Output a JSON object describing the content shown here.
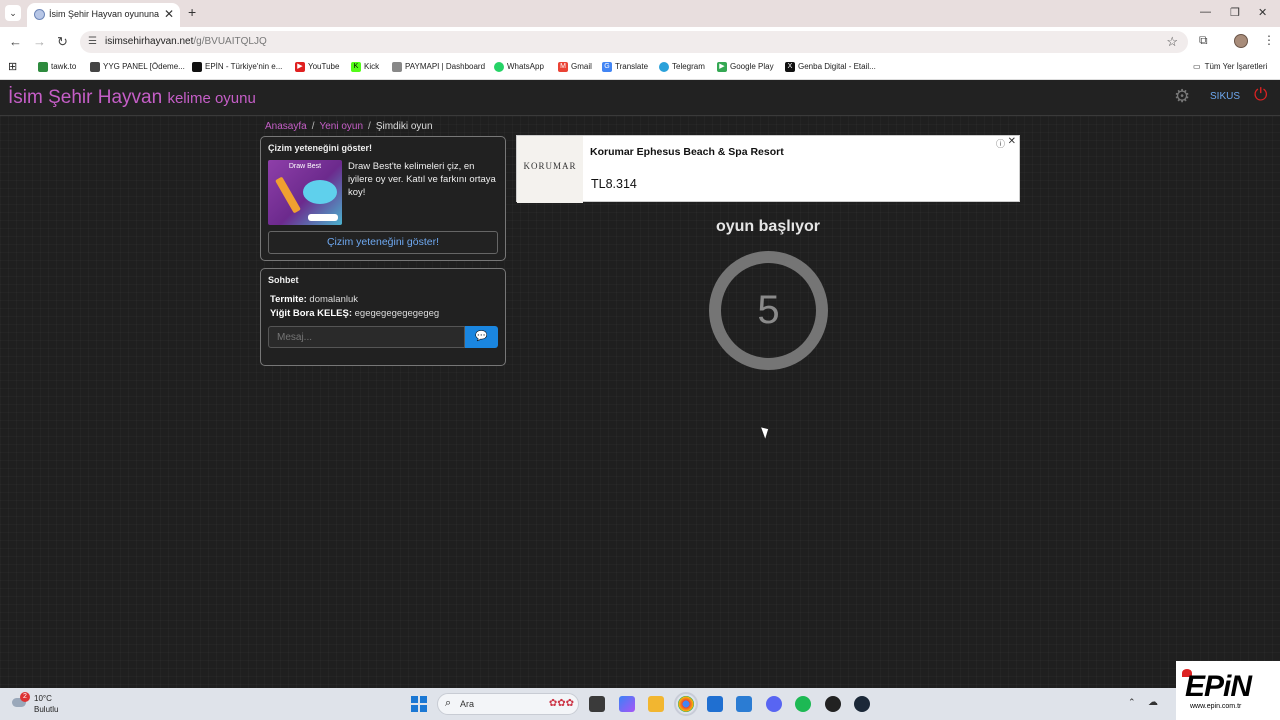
{
  "browser": {
    "tab_title": "İsim Şehir Hayvan oyununa katıl",
    "url_domain": "isimsehirhayvan.net",
    "url_path": "/g/BVUAITQLJQ",
    "bookmarks": [
      {
        "label": "tawk.to",
        "color": "#2e8b3e"
      },
      {
        "label": "YYG PANEL [Ödeme...",
        "color": "#444444"
      },
      {
        "label": "EPİN - Türkiye'nin e...",
        "color": "#111111"
      },
      {
        "label": "YouTube",
        "color": "#e02020"
      },
      {
        "label": "Kick",
        "color": "#53fc18"
      },
      {
        "label": "PAYMAPI | Dashboard",
        "color": "#888888"
      },
      {
        "label": "WhatsApp",
        "color": "#25d366"
      },
      {
        "label": "Gmail",
        "color": "#ea4335"
      },
      {
        "label": "Translate",
        "color": "#4285f4"
      },
      {
        "label": "Telegram",
        "color": "#2aa1da"
      },
      {
        "label": "Google Play",
        "color": "#34a853"
      },
      {
        "label": "Genba Digital - Etail...",
        "color": "#111111"
      }
    ],
    "all_bookmarks": "Tüm Yer İşaretleri"
  },
  "site": {
    "brand": "İsim Şehir Hayvan",
    "brand_sub": "kelime oyunu",
    "username": "SIKUS",
    "brand_color": "#c55ec7"
  },
  "breadcrumb": {
    "home": "Anasayfa",
    "new_game": "Yeni oyun",
    "current": "Şimdiki oyun"
  },
  "promo": {
    "title": "Çizim yeteneğini göster!",
    "image_caption": "Draw Best",
    "description": "Draw Best'te kelimeleri çiz, en iyilere oy ver. Katıl ve farkını ortaya koy!",
    "button": "Çizim yeteneğini göster!"
  },
  "chat": {
    "title": "Sohbet",
    "messages": [
      {
        "user": "Termite:",
        "text": "domalanluk"
      },
      {
        "user": "Yiğit Bora KELEŞ:",
        "text": "egegegegegegegeg"
      }
    ],
    "placeholder": "Mesaj..."
  },
  "ad": {
    "logo": "KORUMAR",
    "title": "Korumar Ephesus Beach & Spa Resort",
    "price": "TL8.314"
  },
  "game": {
    "status": "oyun başlıyor",
    "countdown": "5"
  },
  "taskbar": {
    "weather_alerts": "2",
    "temperature": "10°C",
    "weather_desc": "Bulutlu",
    "search_label": "Ara"
  },
  "watermark": {
    "logo": "EPiN",
    "url": "www.epin.com.tr"
  }
}
